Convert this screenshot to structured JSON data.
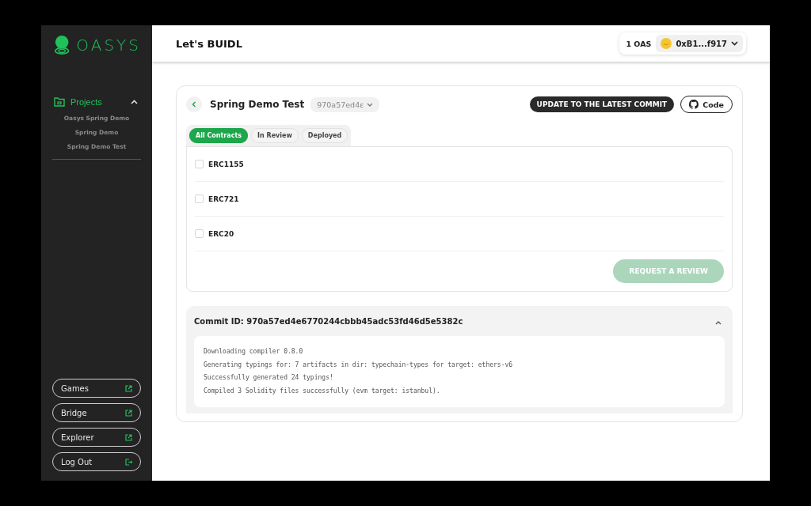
{
  "sidebar": {
    "logo": "OASYS",
    "section": {
      "label": "Projects",
      "expanded": true,
      "items": [
        "Oasys Spring Demo",
        "Spring Demo",
        "Spring Demo Test"
      ]
    },
    "links": [
      {
        "label": "Games",
        "kind": "external"
      },
      {
        "label": "Bridge",
        "kind": "external"
      },
      {
        "label": "Explorer",
        "kind": "external"
      },
      {
        "label": "Log Out",
        "kind": "logout"
      }
    ]
  },
  "header": {
    "title": "Let's BUIDL",
    "balance": "1 OAS",
    "account": "0xB1...f917"
  },
  "project": {
    "name": "Spring Demo Test",
    "commit_select": "970a57ed4ε",
    "update_button": "UPDATE TO THE LATEST COMMIT",
    "code_button": "Code",
    "tabs": [
      {
        "label": "All Contracts",
        "selected": true
      },
      {
        "label": "In Review",
        "selected": false
      },
      {
        "label": "Deployed",
        "selected": false
      }
    ],
    "contracts": [
      {
        "name": "ERC1155",
        "checked": false
      },
      {
        "name": "ERC721",
        "checked": false
      },
      {
        "name": "ERC20",
        "checked": false
      }
    ],
    "review_button": {
      "label": "REQUEST A REVIEW",
      "disabled": true
    }
  },
  "commit": {
    "title": "Commit ID: 970a57ed4e6770244cbbb45adc53fd46d5e5382c",
    "expanded": true,
    "log": [
      "Downloading compiler 0.8.0",
      "Generating typings for: 7 artifacts in dir: typechain-types for target: ethers-v6",
      "Successfully generated 24 typings!",
      "Compiled 3 Solidity files successfully (evm target: istanbul)."
    ]
  }
}
